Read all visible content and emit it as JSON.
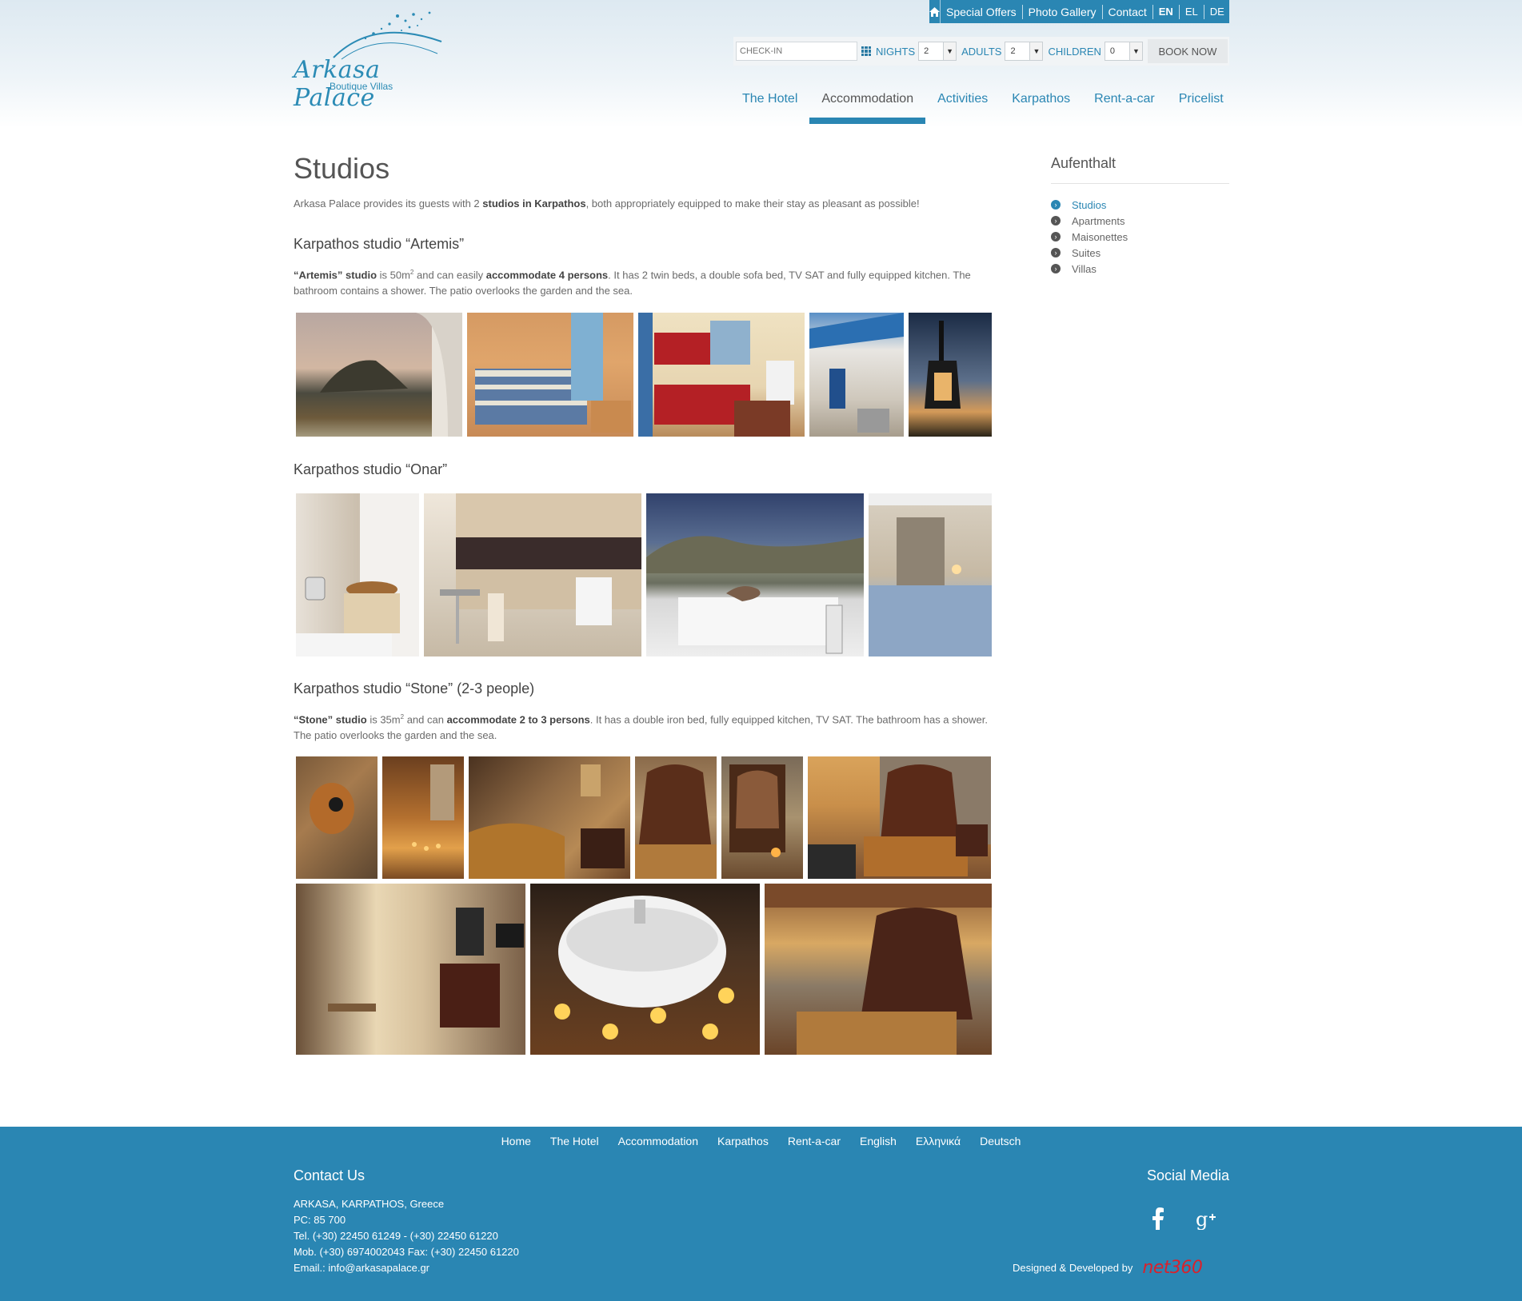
{
  "brand": {
    "name": "Arkasa Palace",
    "tagline": "Boutique Villas"
  },
  "topmenu": {
    "items": [
      "Special Offers",
      "Photo Gallery",
      "Contact"
    ],
    "languages": [
      "EN",
      "EL",
      "DE"
    ],
    "active_language": "EN"
  },
  "booking": {
    "checkin_placeholder": "CHECK-IN",
    "nights_label": "NIGHTS",
    "nights_value": "2",
    "adults_label": "ADULTS",
    "adults_value": "2",
    "children_label": "CHILDREN",
    "children_value": "0",
    "book_label": "BOOK NOW"
  },
  "mainnav": [
    "The Hotel",
    "Accommodation",
    "Activities",
    "Karpathos",
    "Rent-a-car",
    "Pricelist"
  ],
  "mainnav_active": "Accommodation",
  "page": {
    "title": "Studios",
    "intro_a": "Arkasa Palace provides its guests with 2 ",
    "intro_b": "studios in Karpathos",
    "intro_c": ", both appropriately equipped to make their stay as pleasant as possible!"
  },
  "artemis": {
    "heading": "Karpathos studio “Artemis”",
    "t1": "“Artemis” studio",
    "t2": " is 50m",
    "t3": " and can easily ",
    "t4": "accommodate 4 persons",
    "t5": ". It has 2 twin beds, a double sofa bed, TV SAT and fully equipped kitchen. The bathroom contains a shower. The patio overlooks the garden and the sea.",
    "sup": "2"
  },
  "onar": {
    "heading": "Karpathos studio “Onar”"
  },
  "stone": {
    "heading": "Karpathos studio “Stone”  (2-3 people)",
    "t1": "“Stone” studio",
    "t2": " is 35m",
    "t3": " and can ",
    "t4": "accommodate 2 to 3 persons",
    "t5": ". It has a double iron bed, fully equipped kitchen, TV SAT. The bathroom has a shower. The patio overlooks the garden and the sea.",
    "sup": "2"
  },
  "sidebar": {
    "title": "Aufenthalt",
    "items": [
      "Studios",
      "Apartments",
      "Maisonettes",
      "Suites",
      "Villas"
    ],
    "active": "Studios"
  },
  "footer": {
    "nav": [
      "Home",
      "The Hotel",
      "Accommodation",
      "Karpathos",
      "Rent-a-car",
      "English",
      "Ελληνικά",
      "Deutsch"
    ],
    "contact_title": "Contact Us",
    "contact_lines": [
      "ARKASA, KARPATHOS, Greece",
      "PC: 85 700",
      "Tel. (+30) 22450 61249 - (+30) 22450 61220",
      "Mob. (+30) 6974002043 Fax: (+30) 22450 61220",
      "Email.: info@arkasapalace.gr"
    ],
    "social_title": "Social Media",
    "credit": "Designed & Developed by",
    "credit_brand": "net360"
  },
  "icons": [
    "home-icon",
    "calendar-icon",
    "facebook-icon",
    "google-plus-icon",
    "chevron-circle-icon"
  ],
  "colors": {
    "accent": "#2a86b3",
    "footer_bg": "#2a86b3",
    "credit_red": "#d9212c"
  }
}
